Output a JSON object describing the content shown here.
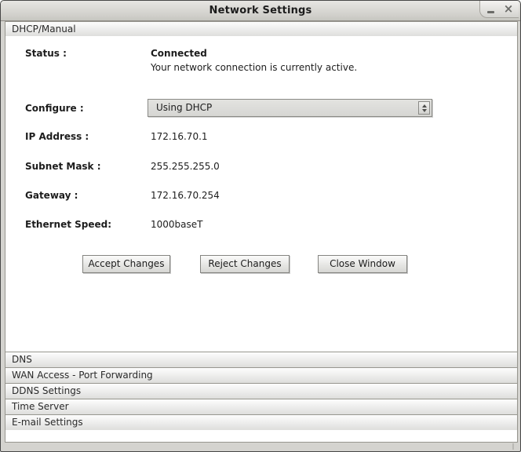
{
  "window": {
    "title": "Network Settings",
    "controls": {
      "minimize_icon": "minimize",
      "close_icon": "×"
    }
  },
  "accordion": {
    "expanded_label": "DHCP/Manual",
    "collapsed": [
      "DNS",
      "WAN Access - Port Forwarding",
      "DDNS Settings",
      "Time Server",
      "E-mail Settings"
    ]
  },
  "form": {
    "status": {
      "label": "Status :",
      "value": "Connected",
      "description": "Your network connection is currently active."
    },
    "configure": {
      "label": "Configure :",
      "value": "Using DHCP"
    },
    "ip": {
      "label": "IP Address :",
      "value": "172.16.70.1"
    },
    "subnet": {
      "label": "Subnet Mask :",
      "value": "255.255.255.0"
    },
    "gateway": {
      "label": "Gateway :",
      "value": "172.16.70.254"
    },
    "ethernet": {
      "label": "Ethernet Speed:",
      "value": "1000baseT"
    }
  },
  "buttons": {
    "accept": "Accept Changes",
    "reject": "Reject Changes",
    "close": "Close Window"
  },
  "colors": {
    "titlebar_bg": "#d7d6d2",
    "header_bg_top": "#fdfdfd",
    "header_bg_bottom": "#dededc",
    "header_border": "#97968f",
    "panel_bg": "#ffffff",
    "text": "#1d1d1d"
  }
}
